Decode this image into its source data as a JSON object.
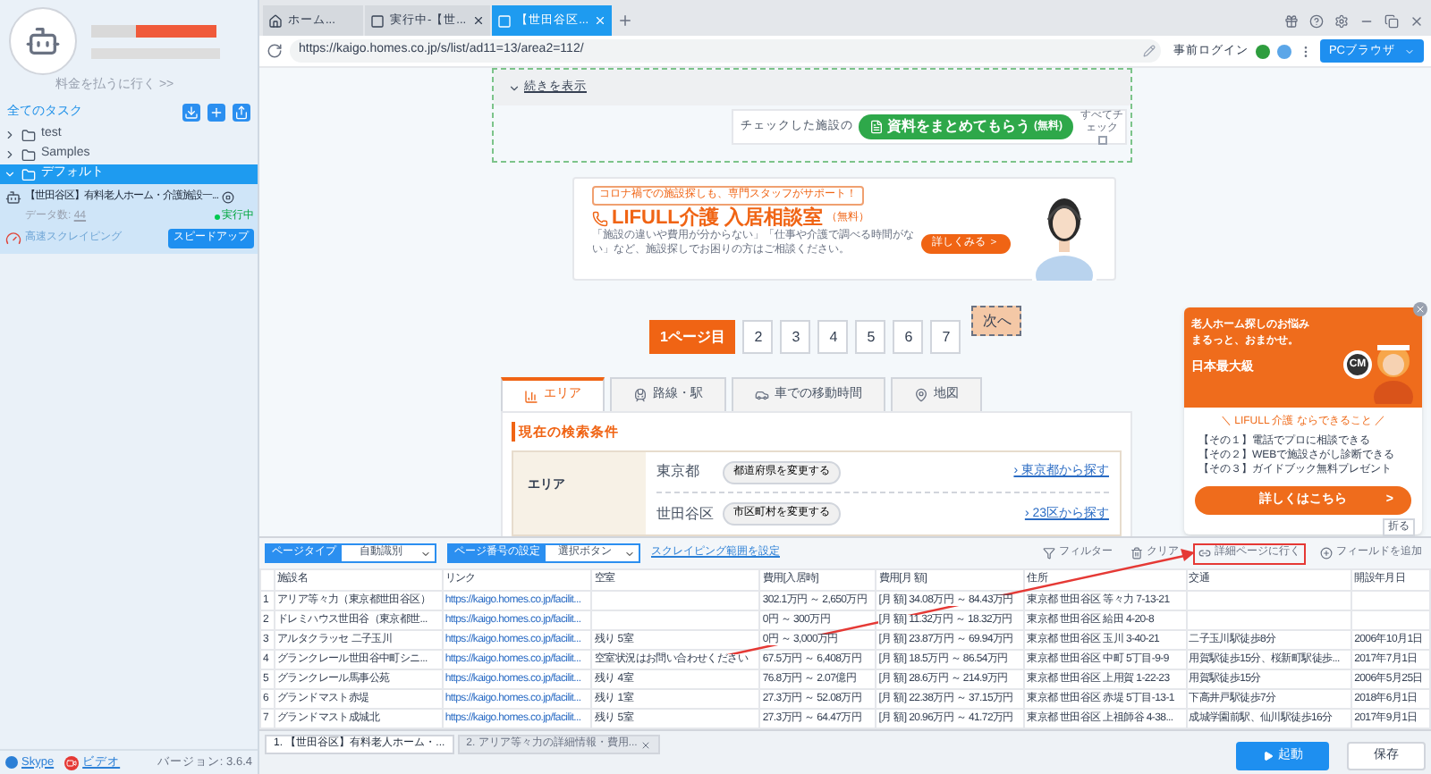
{
  "sidebar": {
    "upgrade_link": "料金を払うに行く >>",
    "section_title": "全てのタスク",
    "folders": [
      {
        "name": "test",
        "selected": false,
        "expanded": false
      },
      {
        "name": "Samples",
        "selected": false,
        "expanded": false
      },
      {
        "name": "デフォルト",
        "selected": true,
        "expanded": true,
        "tasks": [
          {
            "title": "【世田谷区】有料老人ホーム・介護施設一...",
            "count_label": "データ数:",
            "count": "44",
            "status": "実行中",
            "mode": "高速スクレイピング",
            "action": "スピードアップ"
          }
        ]
      }
    ],
    "footer_links": [
      {
        "label": "Skype",
        "kind": "skype"
      },
      {
        "label": "ビデオ",
        "kind": "video"
      }
    ],
    "version": "バージョン: 3.6.4"
  },
  "browser": {
    "tabs": [
      {
        "label": "ホーム...",
        "kind": "home",
        "selected": false,
        "closable": false
      },
      {
        "label": "実行中-【世...",
        "kind": "page",
        "selected": false,
        "closable": true
      },
      {
        "label": "【世田谷区...",
        "kind": "page",
        "selected": true,
        "closable": true
      }
    ],
    "url": "https://kaigo.homes.co.jp/s/list/ad11=13/area2=112/",
    "pre_login": "事前ログイン",
    "mode_button": "PCブラウザ"
  },
  "page": {
    "show_more": "続きを表示",
    "checked_prompt": "チェックした施設の",
    "request_button": "資料をまとめてもらう",
    "request_note": "(無料)",
    "check_all": "すべてチェック",
    "check_all_checked": false,
    "banner": {
      "tagline": "コロナ禍での施設探しも、専門スタッフがサポート！",
      "title": "LIFULL介護 入居相談室",
      "note": "（無料）",
      "description": "「施設の違いや費用が分からない」「仕事や介護で調べる時間がない」など、施設探しでお困りの方はご相談ください。",
      "button": "詳しくみる ＞"
    },
    "pagination": [
      {
        "label": "1ページ目",
        "selected": true
      },
      {
        "label": "2",
        "selected": false
      },
      {
        "label": "3",
        "selected": false
      },
      {
        "label": "4",
        "selected": false
      },
      {
        "label": "5",
        "selected": false
      },
      {
        "label": "6",
        "selected": false
      },
      {
        "label": "7",
        "selected": false
      }
    ],
    "next": "次へ",
    "search_tabs": [
      {
        "label": "エリア",
        "kind": "area",
        "selected": true
      },
      {
        "label": "路線・駅",
        "kind": "train",
        "selected": false
      },
      {
        "label": "車での移動時間",
        "kind": "car",
        "selected": false
      },
      {
        "label": "地図",
        "kind": "map",
        "selected": false
      }
    ],
    "conditions": {
      "title": "現在の検索条件",
      "label": "エリア",
      "rows": [
        {
          "value": "東京都",
          "button": "都道府県を変更する",
          "link": "› 東京都から探す"
        },
        {
          "value": "世田谷区",
          "button": "市区町村を変更する",
          "link": "› 23区から探す"
        }
      ]
    },
    "popup": {
      "headline": [
        "老人ホーム探しのお悩み",
        "まるっと、おまかせ。"
      ],
      "badge": "日本最大級",
      "cm": "CM",
      "subtitle": "＼ LIFULL 介護 ならできること ／",
      "items": [
        "【その１】電話でプロに相談できる",
        "【その２】WEBで施設さがし診断できる",
        "【その３】ガイドブック無料プレゼント"
      ],
      "button": "詳しくはこちら",
      "arrow": ">"
    },
    "fold": "折る"
  },
  "panel": {
    "selectors": [
      {
        "label": "ページタイプ",
        "value": "自動識別"
      },
      {
        "label": "ページ番号の設定",
        "value": "選択ボタン"
      }
    ],
    "range_link": "スクレイピング範囲を設定",
    "tools": [
      {
        "label": "フィルター",
        "kind": "filter",
        "highlighted": false
      },
      {
        "label": "クリア",
        "kind": "clear",
        "highlighted": false
      },
      {
        "label": "詳細ページに行く",
        "kind": "detail",
        "highlighted": true
      },
      {
        "label": "フィールドを追加",
        "kind": "add",
        "highlighted": false
      }
    ],
    "columns": [
      "施設名",
      "リンク",
      "空室",
      "費用[入居時]",
      "費用[月 額]",
      "住所",
      "交通",
      "開設年月日"
    ],
    "rows": [
      {
        "index": "1",
        "cells": [
          "アリア等々力（東京都世田谷区）",
          "https://kaigo.homes.co.jp/facilit...",
          "",
          "302.1万円 ～ 2,650万円",
          "[月 額] 34.08万円 ～ 84.43万円",
          "東京都 世田谷区 等々力 7-13-21",
          "",
          ""
        ]
      },
      {
        "index": "2",
        "cells": [
          "ドレミハウス世田谷（東京都世...",
          "https://kaigo.homes.co.jp/facilit...",
          "",
          "0円 ～ 300万円",
          "[月 額] 11.32万円 ～ 18.32万円",
          "東京都 世田谷区 給田 4-20-8",
          "",
          ""
        ]
      },
      {
        "index": "3",
        "cells": [
          "アルタクラッセ 二子玉川",
          "https://kaigo.homes.co.jp/facilit...",
          "残り 5室",
          "0円 ～ 3,000万円",
          "[月 額] 23.87万円 ～ 69.94万円",
          "東京都 世田谷区 玉川 3-40-21",
          "二子玉川駅徒歩8分",
          "2006年10月1日"
        ]
      },
      {
        "index": "4",
        "cells": [
          "グランクレール世田谷中町シニ...",
          "https://kaigo.homes.co.jp/facilit...",
          "空室状況はお問い合わせください",
          "67.5万円 ～ 6,408万円",
          "[月 額] 18.5万円 ～ 86.54万円",
          "東京都 世田谷区 中町 5丁目-9-9",
          "用賀駅徒歩15分、桜新町駅徒歩...",
          "2017年7月1日"
        ]
      },
      {
        "index": "5",
        "cells": [
          "グランクレール馬事公苑",
          "https://kaigo.homes.co.jp/facilit...",
          "残り 4室",
          "76.8万円 ～ 2.07億円",
          "[月 額] 28.6万円 ～ 214.9万円",
          "東京都 世田谷区 上用賀 1-22-23",
          "用賀駅徒歩15分",
          "2006年5月25日"
        ]
      },
      {
        "index": "6",
        "cells": [
          "グランドマスト赤堤",
          "https://kaigo.homes.co.jp/facilit...",
          "残り 1室",
          "27.3万円 ～ 52.08万円",
          "[月 額] 22.38万円 ～ 37.15万円",
          "東京都 世田谷区 赤堤 5丁目-13-1",
          "下高井戸駅徒歩7分",
          "2018年6月1日"
        ]
      },
      {
        "index": "7",
        "cells": [
          "グランドマスト成城北",
          "https://kaigo.homes.co.jp/facilit...",
          "残り 5室",
          "27.3万円 ～ 64.47万円",
          "[月 額] 20.96万円 ～ 41.72万円",
          "東京都 世田谷区 上祖師谷 4-38...",
          "成城学園前駅、仙川駅徒歩16分",
          "2017年9月1日"
        ]
      }
    ]
  },
  "bottom": {
    "task_tabs": [
      {
        "label": "1. 【世田谷区】有料老人ホーム・...",
        "selected": true,
        "closable": false
      },
      {
        "label": "2. アリア等々力の詳細情報・費用...",
        "selected": false,
        "closable": true
      }
    ],
    "run": "起動",
    "save": "保存"
  }
}
